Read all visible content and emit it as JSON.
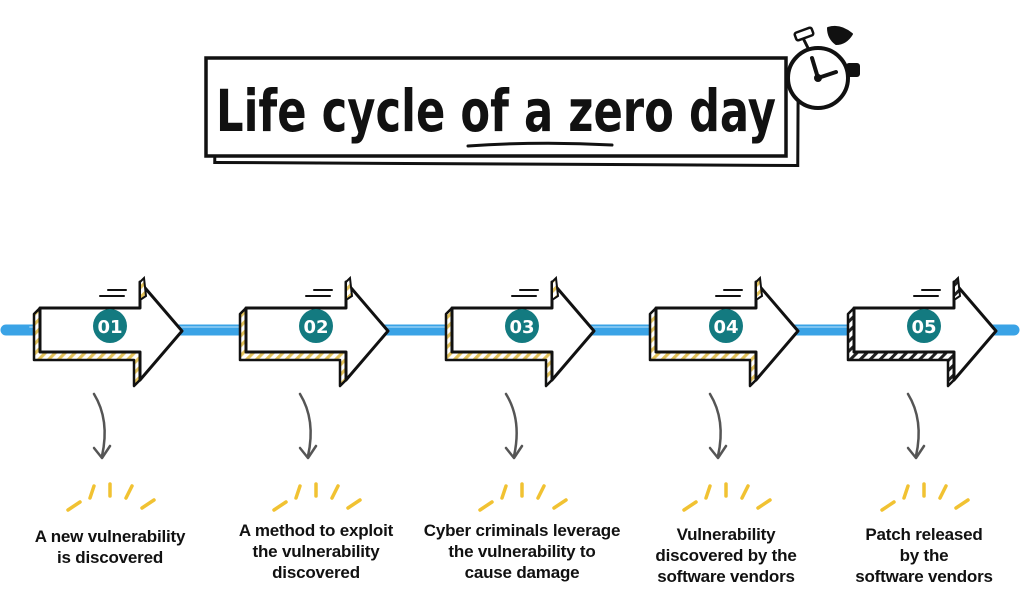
{
  "title": "Life cycle of a zero day",
  "colors": {
    "timeline": "#3aa3e6",
    "badge": "#137a80",
    "hatch": "#e2c25c",
    "accent": "#f1c232",
    "ink": "#111111"
  },
  "icons": {
    "title_decoration": "stopwatch-icon",
    "step_arrow": "arrow-right-icon",
    "pointer": "curved-arrow-down-icon",
    "emphasis": "sparkle-rays-icon"
  },
  "steps": [
    {
      "number": "01",
      "lines": [
        "A new vulnerability",
        "is discovered"
      ]
    },
    {
      "number": "02",
      "lines": [
        "A method to exploit",
        "the vulnerability",
        "discovered"
      ]
    },
    {
      "number": "03",
      "lines": [
        "Cyber criminals leverage",
        "the vulnerability to",
        "cause damage"
      ]
    },
    {
      "number": "04",
      "lines": [
        "Vulnerability",
        "discovered by the",
        "software vendors"
      ]
    },
    {
      "number": "05",
      "lines": [
        "Patch released",
        "by the",
        "software vendors"
      ]
    }
  ]
}
